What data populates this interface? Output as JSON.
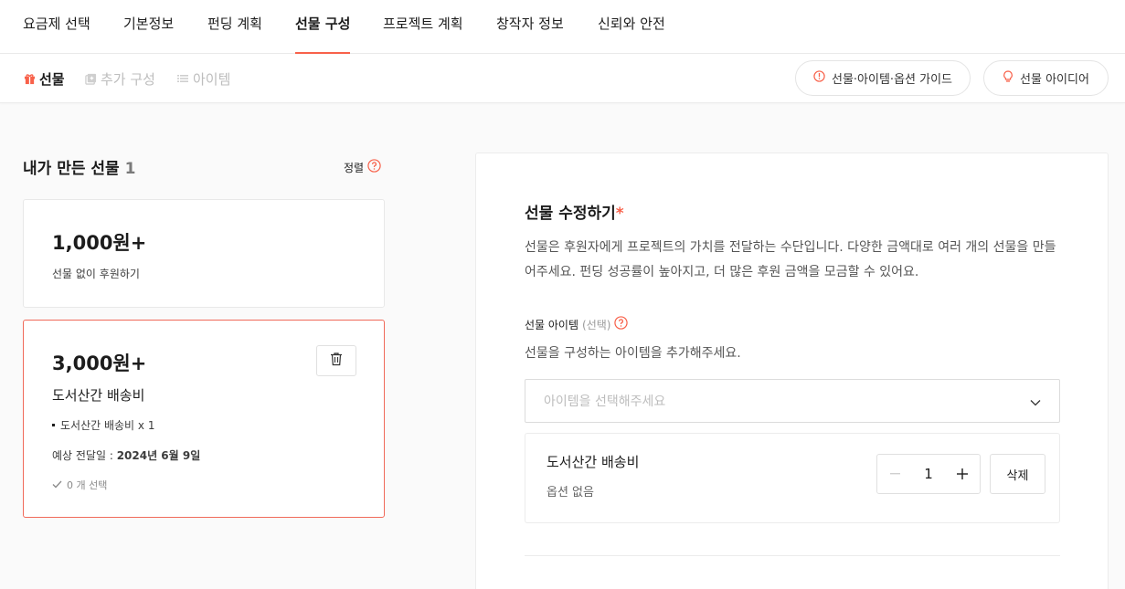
{
  "top_tabs": [
    {
      "label": "요금제 선택"
    },
    {
      "label": "기본정보"
    },
    {
      "label": "펀딩 계획"
    },
    {
      "label": "선물 구성"
    },
    {
      "label": "프로젝트 계획"
    },
    {
      "label": "창작자 정보"
    },
    {
      "label": "신뢰와 안전"
    }
  ],
  "sub_tabs": [
    {
      "label": "선물",
      "icon": "gift-icon"
    },
    {
      "label": "추가 구성",
      "icon": "add-copy-icon"
    },
    {
      "label": "아이템",
      "icon": "list-icon"
    }
  ],
  "header_buttons": {
    "guide_label": "선물·아이템·옵션 가이드",
    "idea_label": "선물 아이디어"
  },
  "left": {
    "title": "내가 만든 선물",
    "count": "1",
    "sort_label": "정렬",
    "cards": [
      {
        "price": "1,000원+",
        "desc": "선물 없이 후원하기"
      },
      {
        "price": "3,000원+",
        "name": "도서산간 배송비",
        "item_line": "도서산간 배송비 x 1",
        "delivery_label": "예상 전달일 : ",
        "delivery_date": "2024년 6월 9일",
        "selected_count": "0 개 선택"
      }
    ]
  },
  "panel": {
    "title": "선물 수정하기",
    "required_mark": "*",
    "description": "선물은 후원자에게 프로젝트의 가치를 전달하는 수단입니다. 다양한 금액대로 여러 개의 선물을 만들어주세요. 펀딩 성공률이 높아지고, 더 많은 후원 금액을 모금할 수 있어요.",
    "item_label": "선물 아이템",
    "item_optional": "(선택)",
    "item_help": "선물을 구성하는 아이템을 추가해주세요.",
    "select_placeholder": "아이템을 선택해주세요",
    "item": {
      "name": "도서산간 배송비",
      "option": "옵션 없음",
      "quantity": "1",
      "delete_label": "삭제"
    }
  },
  "colors": {
    "accent": "#f8614a",
    "border": "#e8e8e8",
    "muted": "#bdbdbd"
  }
}
